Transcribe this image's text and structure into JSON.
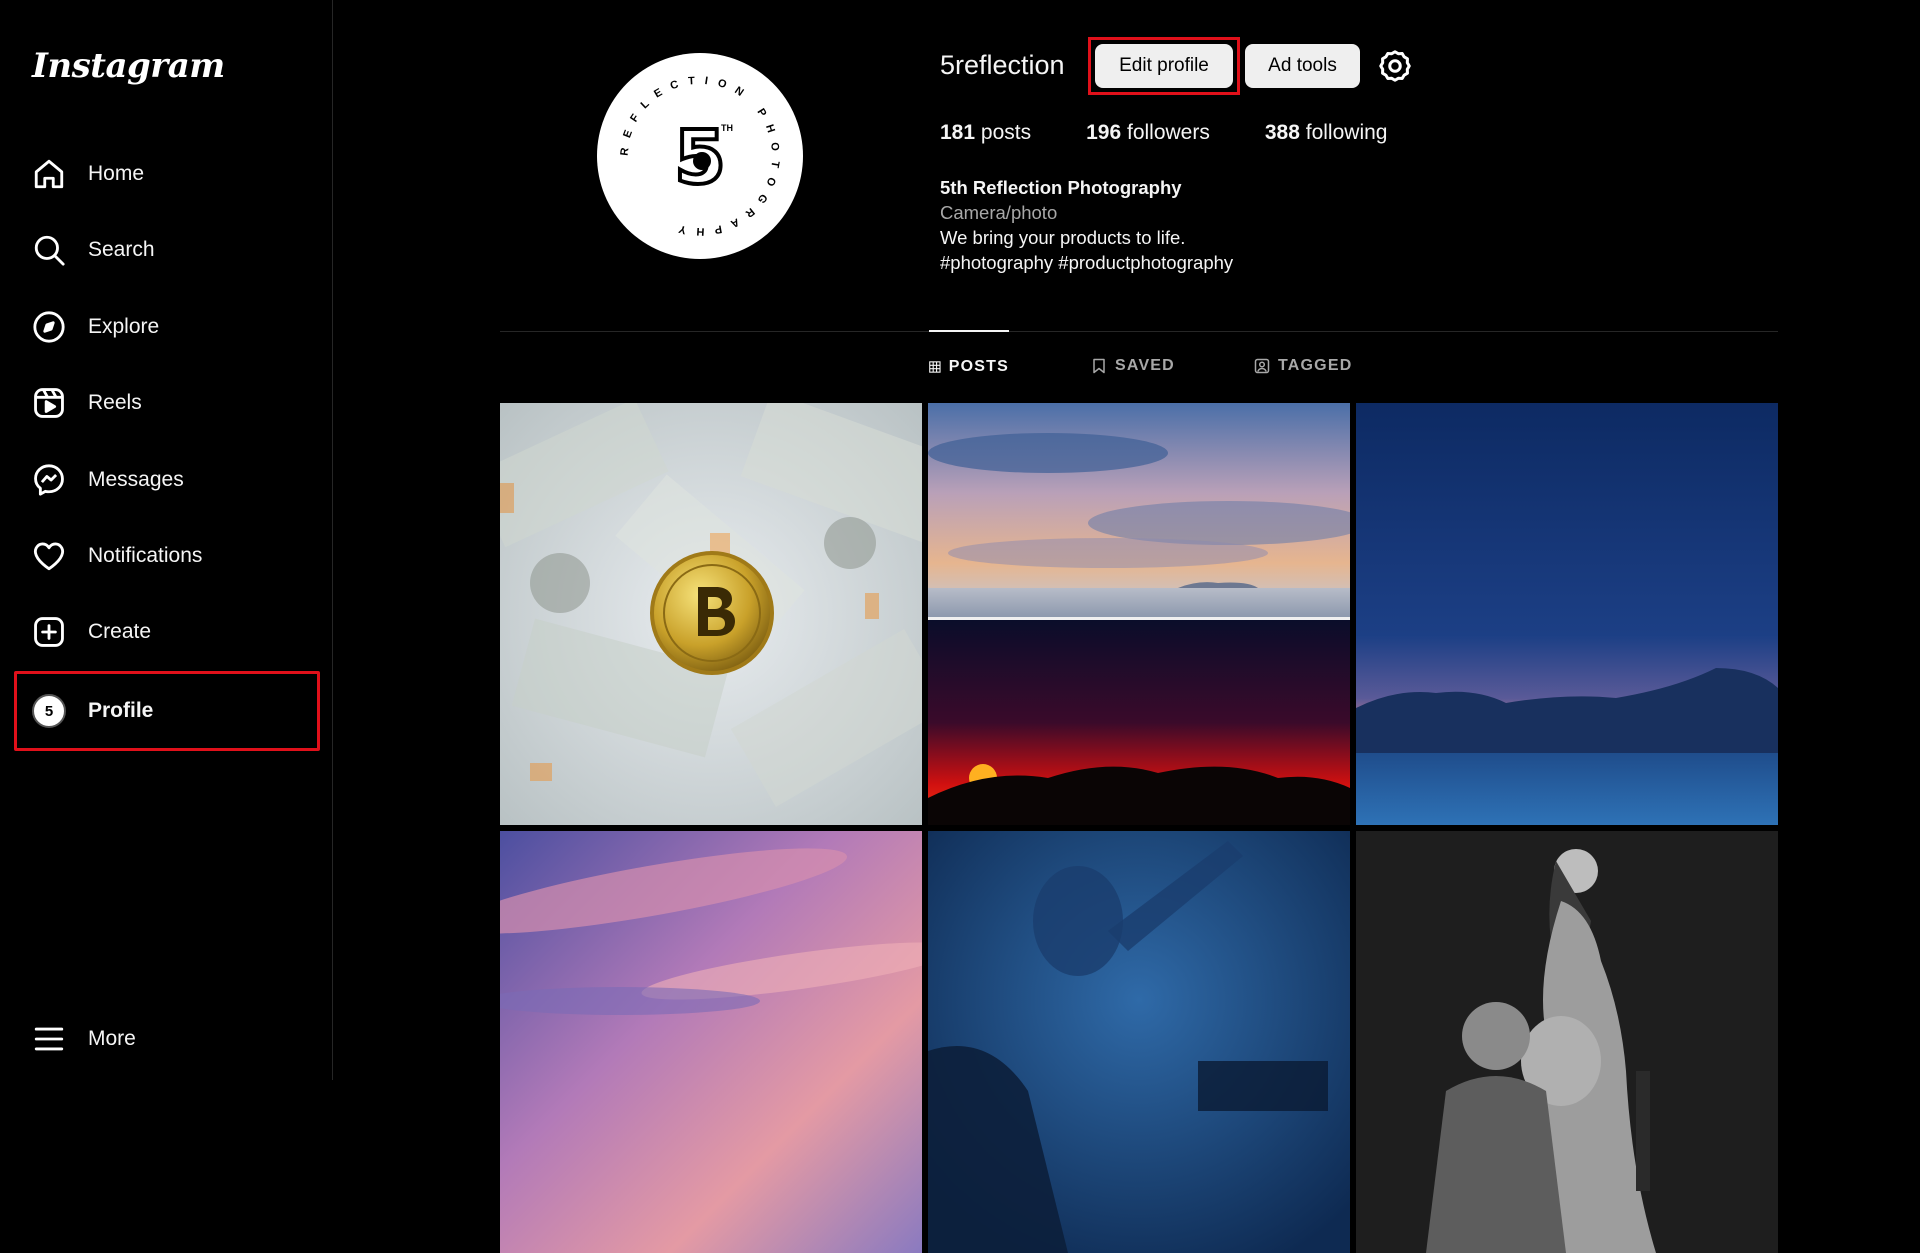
{
  "app": {
    "logo": "Instagram"
  },
  "sidebar": {
    "items": [
      {
        "label": "Home",
        "icon": "home-icon"
      },
      {
        "label": "Search",
        "icon": "search-icon"
      },
      {
        "label": "Explore",
        "icon": "compass-icon"
      },
      {
        "label": "Reels",
        "icon": "reels-icon"
      },
      {
        "label": "Messages",
        "icon": "messenger-icon"
      },
      {
        "label": "Notifications",
        "icon": "heart-icon"
      },
      {
        "label": "Create",
        "icon": "plus-square-icon"
      },
      {
        "label": "Profile",
        "icon": "avatar"
      }
    ],
    "more": {
      "label": "More",
      "icon": "menu-icon"
    }
  },
  "profile": {
    "username": "5reflection",
    "edit_label": "Edit profile",
    "ad_tools_label": "Ad tools",
    "stats": {
      "posts_count": "181",
      "posts_label": "posts",
      "followers_count": "196",
      "followers_label": "followers",
      "following_count": "388",
      "following_label": "following"
    },
    "bio": {
      "name": "5th Reflection Photography",
      "category": "Camera/photo",
      "line1": "We bring your products to life.",
      "line2": "#photography #productphotography"
    },
    "logo_text": {
      "ring": "REFLECTION PHOTOGRAPHY",
      "number": "5",
      "suffix": "TH"
    }
  },
  "tabs": [
    {
      "label": "POSTS",
      "icon": "grid-icon"
    },
    {
      "label": "SAVED",
      "icon": "bookmark-icon"
    },
    {
      "label": "TAGGED",
      "icon": "tag-person-icon"
    }
  ],
  "colors": {
    "highlight": "#e0101a",
    "background": "#000000",
    "button": "#efefef"
  }
}
